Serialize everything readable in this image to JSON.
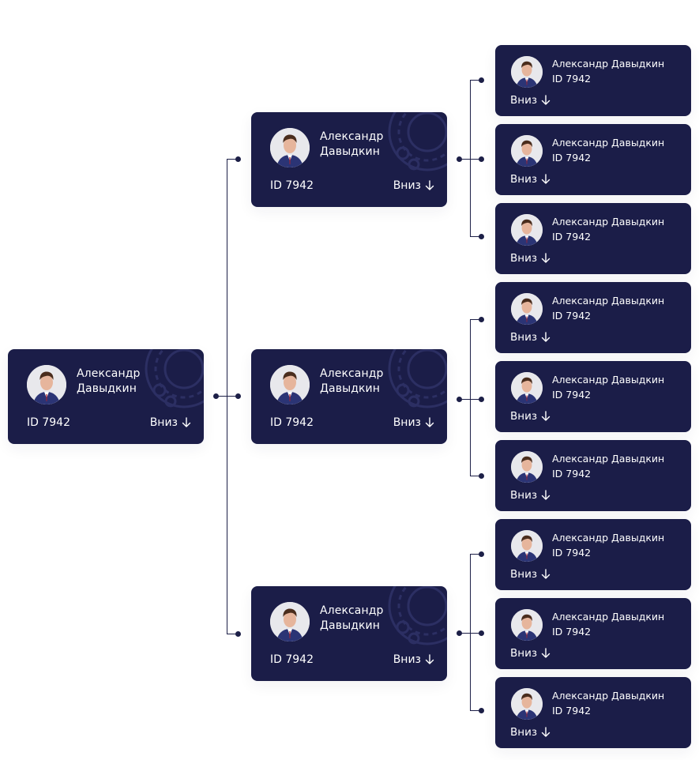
{
  "person": {
    "name_line1": "Александр",
    "name_line2": "Давыдкин",
    "name_full": "Александр Давыдкин",
    "id": "ID 7942",
    "down_label": "Вниз"
  },
  "colors": {
    "card_bg": "#1b1d48",
    "line": "#1c1f47",
    "text": "#ffffff"
  },
  "icons": {
    "down": "arrow-down-icon",
    "avatar": "avatar-photo"
  },
  "tree": {
    "root": {
      "name": [
        "Александр",
        "Давыдкин"
      ],
      "id": "ID 7942",
      "down": "Вниз",
      "children": [
        {
          "name": [
            "Александр",
            "Давыдкин"
          ],
          "id": "ID 7942",
          "down": "Вниз",
          "children": [
            {
              "name": "Александр Давыдкин",
              "id": "ID 7942",
              "down": "Вниз"
            },
            {
              "name": "Александр Давыдкин",
              "id": "ID 7942",
              "down": "Вниз"
            },
            {
              "name": "Александр Давыдкин",
              "id": "ID 7942",
              "down": "Вниз"
            }
          ]
        },
        {
          "name": [
            "Александр",
            "Давыдкин"
          ],
          "id": "ID 7942",
          "down": "Вниз",
          "children": [
            {
              "name": "Александр Давыдкин",
              "id": "ID 7942",
              "down": "Вниз"
            },
            {
              "name": "Александр Давыдкин",
              "id": "ID 7942",
              "down": "Вниз"
            },
            {
              "name": "Александр Давыдкин",
              "id": "ID 7942",
              "down": "Вниз"
            }
          ]
        },
        {
          "name": [
            "Александр",
            "Давыдкин"
          ],
          "id": "ID 7942",
          "down": "Вниз",
          "children": [
            {
              "name": "Александр Давыдкин",
              "id": "ID 7942",
              "down": "Вниз"
            },
            {
              "name": "Александр Давыдкин",
              "id": "ID 7942",
              "down": "Вниз"
            },
            {
              "name": "Александр Давыдкин",
              "id": "ID 7942",
              "down": "Вниз"
            }
          ]
        }
      ]
    }
  }
}
